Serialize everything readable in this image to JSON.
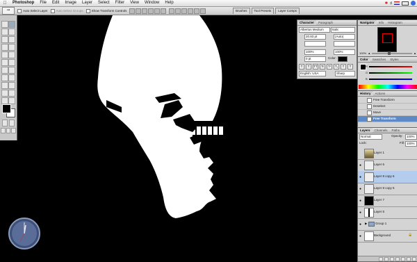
{
  "menubar": {
    "app_name": "Photoshop",
    "items": [
      "File",
      "Edit",
      "Image",
      "Layer",
      "Select",
      "Filter",
      "View",
      "Window",
      "Help"
    ],
    "status_icons": [
      "bluetooth-icon",
      "volume-icon",
      "flag-icon",
      "battery-icon",
      "search-icon"
    ]
  },
  "options_bar": {
    "tool": "move-tool-icon",
    "auto_select_layer": "Auto Select Layer",
    "auto_select_groups": "Auto Select Groups",
    "show_transform_controls": "Show Transform Controls"
  },
  "palette_well": {
    "tabs": [
      "Brushes",
      "Tool Presets",
      "Layer Comps"
    ]
  },
  "character_panel": {
    "tabs": [
      "Character",
      "Paragraph"
    ],
    "font_family": "Albertus Medium",
    "font_style": "Italic",
    "font_size": "20.83 pt",
    "leading": "(Auto)",
    "vertical_scale": "100%",
    "horizontal_scale": "100%",
    "baseline_shift": "0 pt",
    "color_label": "Color:",
    "language": "English: USA",
    "antialias": "Sharp",
    "style_buttons": [
      "T",
      "T",
      "TT",
      "Tr",
      "T¹",
      "T₁",
      "T",
      "T"
    ]
  },
  "navigator_panel": {
    "tabs": [
      "Navigator",
      "Info",
      "Histogram"
    ],
    "zoom": "100%"
  },
  "color_panel": {
    "tabs": [
      "Color",
      "Swatches",
      "Styles"
    ],
    "channels": [
      "R",
      "G",
      "B"
    ]
  },
  "history_panel": {
    "tabs": [
      "History",
      "Actions"
    ],
    "states": [
      "Free Transform",
      "Deselect",
      "Move",
      "Free Transform"
    ],
    "selected_index": 3
  },
  "layers_panel": {
    "tabs": [
      "Layers",
      "Channels",
      "Paths"
    ],
    "blend_mode": "Normal",
    "opacity_label": "Opacity:",
    "opacity": "100%",
    "lock_label": "Lock:",
    "fill_label": "Fill:",
    "fill": "100%",
    "layers": [
      {
        "name": "Layer 1",
        "visible": false
      },
      {
        "name": "Layer 6",
        "visible": true
      },
      {
        "name": "Layer 8 copy 6",
        "visible": true
      },
      {
        "name": "Layer 8 copy 5",
        "visible": true
      },
      {
        "name": "Layer 7",
        "visible": true
      },
      {
        "name": "Layer 5",
        "visible": true
      },
      {
        "name": "Group 1",
        "visible": true
      },
      {
        "name": "Background",
        "visible": true
      }
    ],
    "selected_index": 2
  },
  "colors": {
    "canvas_background": "#000000",
    "skull": "#ffffff",
    "selection": "#5e89c7",
    "panel": "#d4d4d4"
  }
}
